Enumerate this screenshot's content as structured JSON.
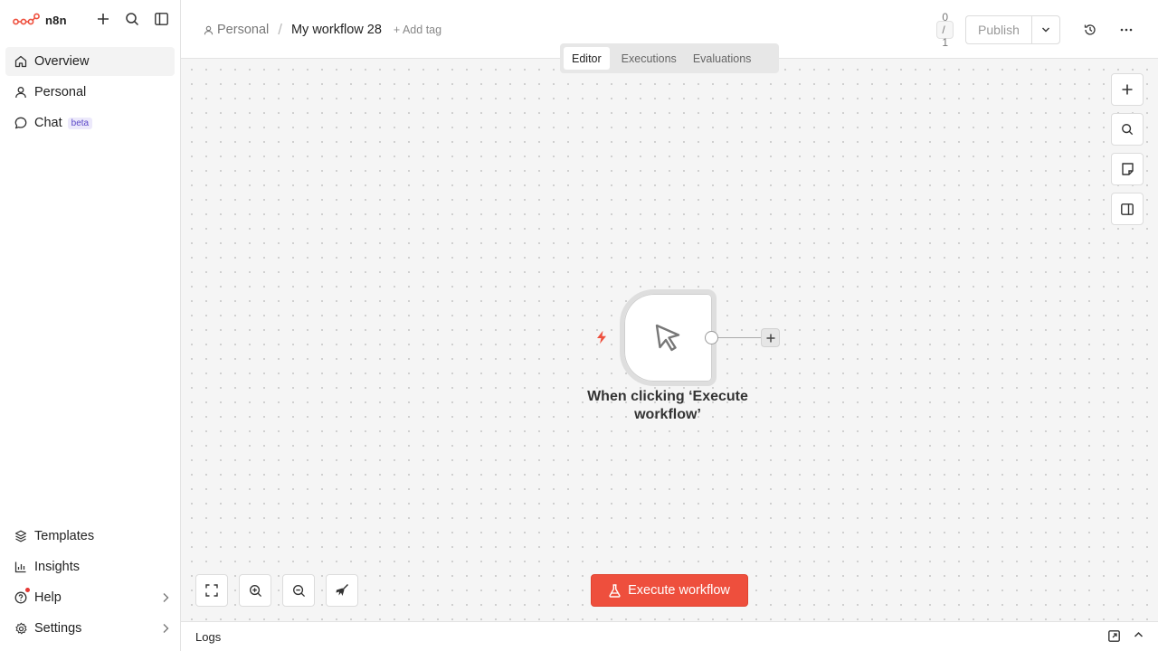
{
  "brand": {
    "name": "n8n",
    "color": "#ee4f3d"
  },
  "sidebar": {
    "top_items": [
      {
        "label": "Overview",
        "icon": "home-icon",
        "active": true
      },
      {
        "label": "Personal",
        "icon": "user-icon"
      },
      {
        "label": "Chat",
        "icon": "chat-icon",
        "badge": "beta"
      }
    ],
    "bottom_items": [
      {
        "label": "Templates",
        "icon": "templates-icon"
      },
      {
        "label": "Insights",
        "icon": "chart-icon"
      },
      {
        "label": "Help",
        "icon": "help-icon",
        "has_chevron": true,
        "notification_dot": true
      },
      {
        "label": "Settings",
        "icon": "gear-icon",
        "has_chevron": true
      }
    ]
  },
  "header": {
    "project": "Personal",
    "workflow_name": "My workflow 28",
    "add_tag": "+ Add tag",
    "counter": "0 / 1",
    "publish_label": "Publish"
  },
  "tabs": [
    {
      "label": "Editor",
      "active": true
    },
    {
      "label": "Executions"
    },
    {
      "label": "Evaluations"
    }
  ],
  "node": {
    "label": "When clicking ‘Execute workflow’",
    "icon": "cursor-pointer-icon",
    "trigger_icon": "lightning-icon",
    "trigger_color": "#ee4f3d"
  },
  "execute_button": {
    "label": "Execute workflow",
    "icon": "flask-icon",
    "color": "#ee4f3d"
  },
  "logs": {
    "title": "Logs"
  }
}
